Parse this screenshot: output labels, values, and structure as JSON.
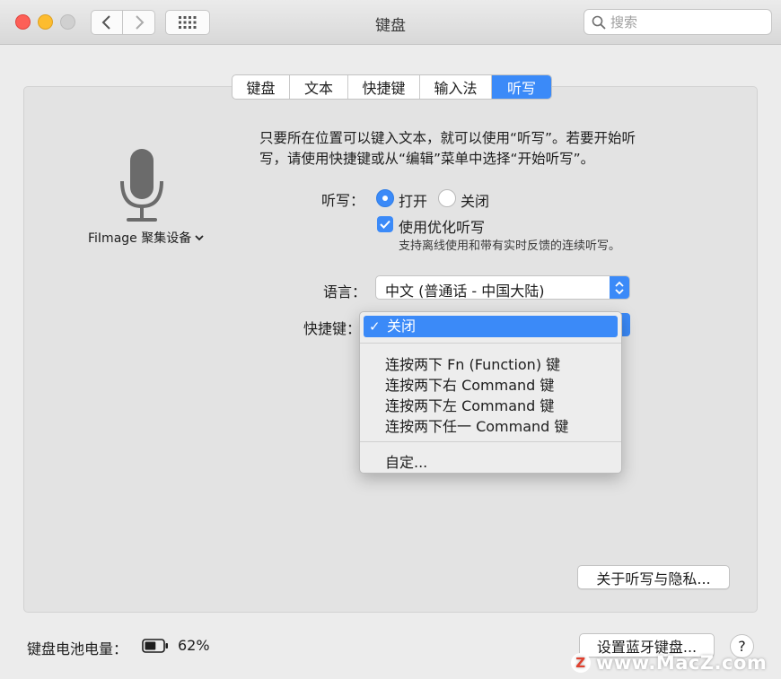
{
  "window": {
    "title": "键盘"
  },
  "search": {
    "placeholder": "搜索"
  },
  "tabs": [
    {
      "label": "键盘"
    },
    {
      "label": "文本"
    },
    {
      "label": "快捷键"
    },
    {
      "label": "输入法"
    },
    {
      "label": "听写",
      "active": true
    }
  ],
  "mic": {
    "device": "FiImage 聚集设备"
  },
  "dictation": {
    "description_line1": "只要所在位置可以键入文本，就可以使用“听写”。若要开始听",
    "description_line2": "写，请使用快捷键或从“编辑”菜单中选择“开始听写”。",
    "label": "听写：",
    "on_label": "打开",
    "off_label": "关闭",
    "enhanced_label": "使用优化听写",
    "enhanced_sub": "支持离线使用和带有实时反馈的连续听写。",
    "language_label": "语言：",
    "language_value": "中文 (普通话 - 中国大陆)",
    "shortcut_label": "快捷键："
  },
  "shortcut_menu": {
    "selected": "关闭",
    "items": [
      "连按两下 Fn (Function) 键",
      "连按两下右 Command 键",
      "连按两下左 Command 键",
      "连按两下任一 Command 键"
    ],
    "custom": "自定..."
  },
  "buttons": {
    "privacy": "关于听写与隐私...",
    "bluetooth": "设置蓝牙键盘...",
    "help": "?"
  },
  "battery": {
    "label": "键盘电池电量：",
    "value": "62%",
    "level": 0.62
  },
  "watermark": {
    "text": "www.MacZ.com",
    "logo": "Z"
  },
  "colors": {
    "accent": "#3b8af8"
  }
}
